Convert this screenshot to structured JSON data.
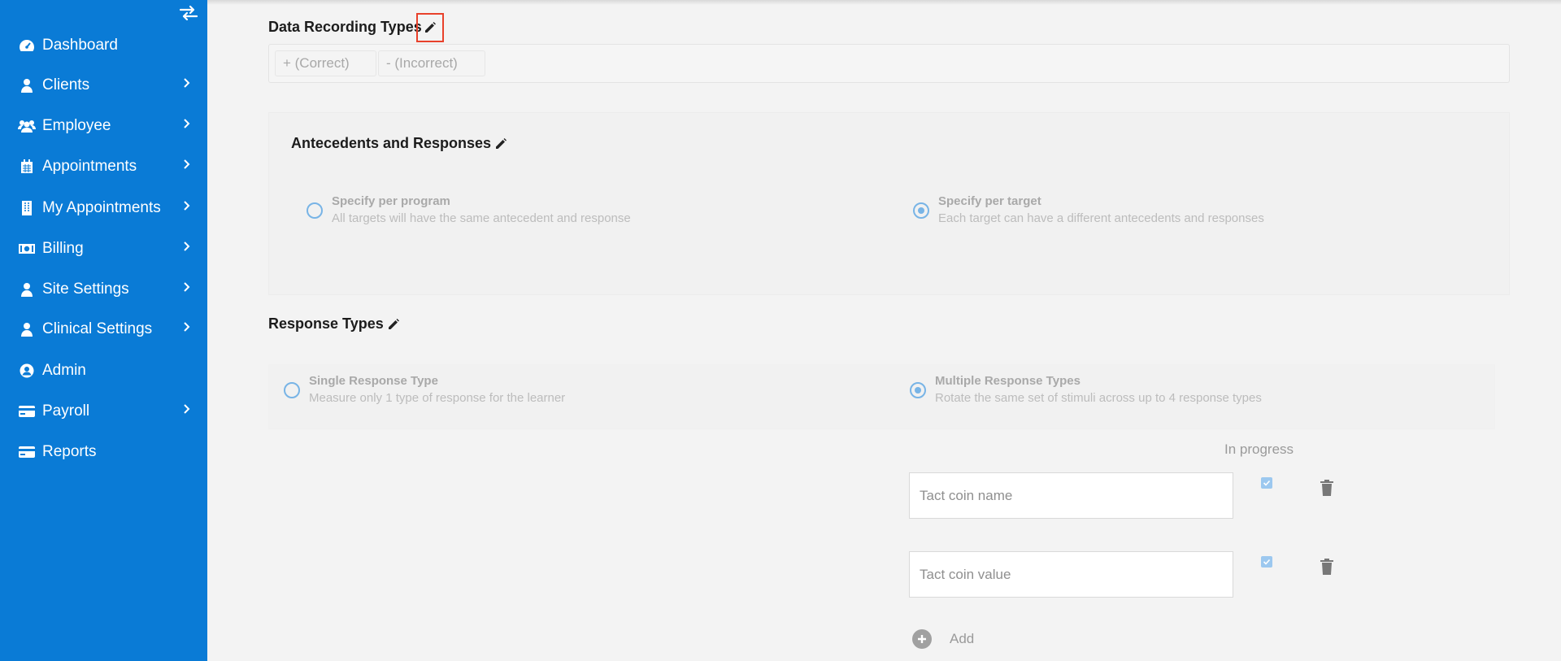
{
  "sidebar": {
    "toggle_icon": "swap-arrows-icon",
    "items": [
      {
        "label": "Dashboard",
        "icon": "dashboard-icon",
        "has_submenu": false
      },
      {
        "label": "Clients",
        "icon": "user-icon",
        "has_submenu": true
      },
      {
        "label": "Employee",
        "icon": "users-icon",
        "has_submenu": true
      },
      {
        "label": "Appointments",
        "icon": "calendar-icon",
        "has_submenu": true
      },
      {
        "label": "My Appointments",
        "icon": "building-icon",
        "has_submenu": true
      },
      {
        "label": "Billing",
        "icon": "money-icon",
        "has_submenu": true
      },
      {
        "label": "Site Settings",
        "icon": "user-icon",
        "has_submenu": true
      },
      {
        "label": "Clinical Settings",
        "icon": "user-icon",
        "has_submenu": true
      },
      {
        "label": "Admin",
        "icon": "user-circle-icon",
        "has_submenu": false
      },
      {
        "label": "Payroll",
        "icon": "credit-card-icon",
        "has_submenu": true
      },
      {
        "label": "Reports",
        "icon": "credit-card-icon",
        "has_submenu": false
      }
    ]
  },
  "data_recording": {
    "title": "Data Recording Types",
    "chips": [
      "+ (Correct)",
      "- (Incorrect)"
    ]
  },
  "antecedents": {
    "title": "Antecedents and Responses",
    "options": [
      {
        "title": "Specify per program",
        "desc": "All targets will have the same antecedent and response",
        "selected": false
      },
      {
        "title": "Specify per target",
        "desc": "Each target can have a different antecedents and responses",
        "selected": true
      }
    ]
  },
  "response_types": {
    "title": "Response Types",
    "options": [
      {
        "title": "Single Response Type",
        "desc": "Measure only 1 type of response for the learner",
        "selected": false
      },
      {
        "title": "Multiple Response Types",
        "desc": "Rotate the same set of stimuli across up to 4 response types",
        "selected": true
      }
    ],
    "in_progress_label": "In progress",
    "fields": [
      {
        "placeholder": "Tact coin name",
        "checked": true
      },
      {
        "placeholder": "Tact coin value",
        "checked": true
      }
    ],
    "add_label": "Add"
  },
  "colors": {
    "sidebar": "#0a7bd6",
    "radio": "#78b4e6",
    "highlight": "#e8412b"
  }
}
